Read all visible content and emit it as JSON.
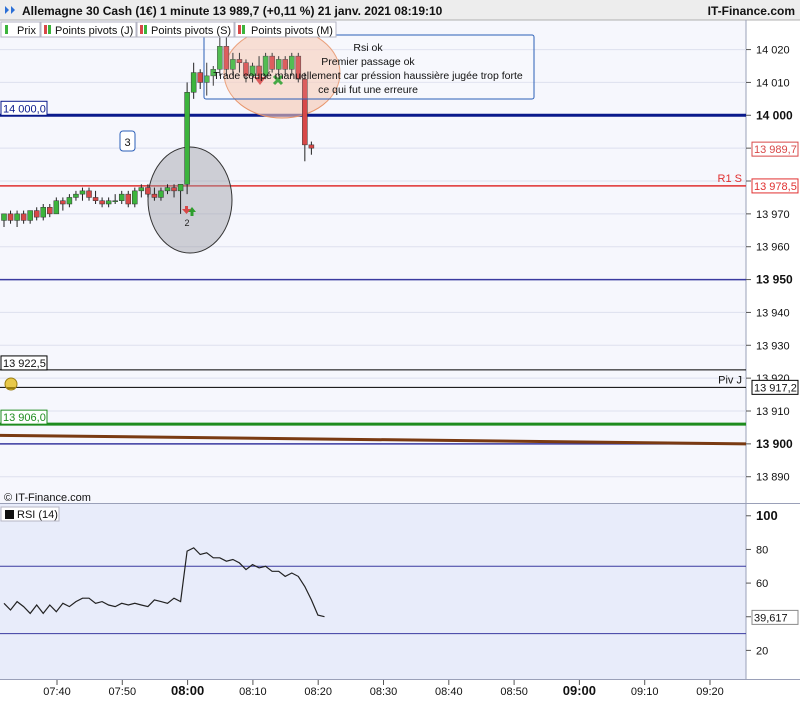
{
  "title_bar": {
    "title": "Allemagne 30 Cash (1€) 1 minute 13 989,7 (+0,11 %) 21 janv. 2021 08:19:10",
    "brand": "IT-Finance.com"
  },
  "tabs": [
    {
      "label": "Prix",
      "icon": "candle-icon"
    },
    {
      "label": "Points pivots (J)",
      "icon": "candle-icon"
    },
    {
      "label": "Points pivots (S)",
      "icon": "candle-icon"
    },
    {
      "label": "Points pivots (M)",
      "icon": "candle-icon"
    }
  ],
  "annotation_box": {
    "lines": [
      "Rsi ok",
      "Premier passage ok",
      "Trade coupé manuellement car préssion haussière jugée trop forte",
      "ce qui fut une erreure"
    ]
  },
  "label_3": "3",
  "label_2": "2",
  "copyright": "© IT-Finance.com",
  "rsi_label": "RSI (14)",
  "colors": {
    "up": "#3cb43c",
    "down": "#d84848",
    "level_14000": "#0a1a8c",
    "r1s": "#e03030",
    "level_13950": "#3a3aa0",
    "level_13906": "#1e8c1e",
    "trend": "#7a3a12",
    "rsi_line": "#222222",
    "rsi_bg": "#e8ecfa",
    "price_bg": "#f6f7fd"
  },
  "chart_data": [
    {
      "type": "candlestick",
      "name": "Allemagne 30 Cash (1€) 1 minute",
      "x_ticks": [
        "07:40",
        "07:50",
        "08:00",
        "08:10",
        "08:20",
        "08:30",
        "08:40",
        "08:50",
        "09:00",
        "09:10",
        "09:20"
      ],
      "x_ticks_bold": [
        "08:00",
        "09:00"
      ],
      "y_ticks": [
        14020,
        14010,
        14000,
        13990,
        13980,
        13970,
        13960,
        13950,
        13940,
        13930,
        13920,
        13910,
        13900,
        13890
      ],
      "y_ticks_labels": [
        "14 020",
        "14 010",
        "14 000",
        "",
        "",
        "13 970",
        "13 960",
        "13 950",
        "13 940",
        "13 930",
        "13 920",
        "13 910",
        "13 900",
        "13 890"
      ],
      "y_ticks_bold": [
        14000,
        13950,
        13900
      ],
      "ylim": [
        13882,
        14029
      ],
      "candles": [
        {
          "o": 13968,
          "h": 13970,
          "l": 13966,
          "c": 13970
        },
        {
          "o": 13970,
          "h": 13971,
          "l": 13967,
          "c": 13968
        },
        {
          "o": 13968,
          "h": 13971,
          "l": 13966,
          "c": 13970
        },
        {
          "o": 13970,
          "h": 13971,
          "l": 13967,
          "c": 13968
        },
        {
          "o": 13968,
          "h": 13971,
          "l": 13967,
          "c": 13971
        },
        {
          "o": 13971,
          "h": 13972,
          "l": 13968,
          "c": 13969
        },
        {
          "o": 13969,
          "h": 13973,
          "l": 13968,
          "c": 13972
        },
        {
          "o": 13972,
          "h": 13973,
          "l": 13969,
          "c": 13970
        },
        {
          "o": 13970,
          "h": 13975,
          "l": 13970,
          "c": 13974
        },
        {
          "o": 13974,
          "h": 13975,
          "l": 13971,
          "c": 13973
        },
        {
          "o": 13973,
          "h": 13976,
          "l": 13972,
          "c": 13975
        },
        {
          "o": 13975,
          "h": 13977,
          "l": 13974,
          "c": 13976
        },
        {
          "o": 13976,
          "h": 13978,
          "l": 13974,
          "c": 13977
        },
        {
          "o": 13977,
          "h": 13978,
          "l": 13974,
          "c": 13975
        },
        {
          "o": 13975,
          "h": 13977,
          "l": 13973,
          "c": 13974
        },
        {
          "o": 13974,
          "h": 13975,
          "l": 13972,
          "c": 13973
        },
        {
          "o": 13973,
          "h": 13975,
          "l": 13972,
          "c": 13974
        },
        {
          "o": 13974,
          "h": 13976,
          "l": 13973,
          "c": 13974
        },
        {
          "o": 13974,
          "h": 13977,
          "l": 13973,
          "c": 13976
        },
        {
          "o": 13976,
          "h": 13977,
          "l": 13972,
          "c": 13973
        },
        {
          "o": 13973,
          "h": 13978,
          "l": 13972,
          "c": 13977
        },
        {
          "o": 13977,
          "h": 13979,
          "l": 13975,
          "c": 13978
        },
        {
          "o": 13978,
          "h": 13979,
          "l": 13975,
          "c": 13976
        },
        {
          "o": 13976,
          "h": 13978,
          "l": 13974,
          "c": 13975
        },
        {
          "o": 13975,
          "h": 13978,
          "l": 13974,
          "c": 13977
        },
        {
          "o": 13977,
          "h": 13979,
          "l": 13976,
          "c": 13978
        },
        {
          "o": 13978,
          "h": 13979,
          "l": 13975,
          "c": 13977
        },
        {
          "o": 13977,
          "h": 13977,
          "l": 13970,
          "c": 13979
        },
        {
          "o": 13979,
          "h": 14010,
          "l": 13976,
          "c": 14007
        },
        {
          "o": 14007,
          "h": 14016,
          "l": 14005,
          "c": 14013
        },
        {
          "o": 14013,
          "h": 14014,
          "l": 14008,
          "c": 14010
        },
        {
          "o": 14010,
          "h": 14016,
          "l": 14006,
          "c": 14012
        },
        {
          "o": 14012,
          "h": 14015,
          "l": 14009,
          "c": 14014
        },
        {
          "o": 14014,
          "h": 14024,
          "l": 14012,
          "c": 14021
        },
        {
          "o": 14021,
          "h": 14024,
          "l": 14012,
          "c": 14014
        },
        {
          "o": 14014,
          "h": 14019,
          "l": 14012,
          "c": 14017
        },
        {
          "o": 14017,
          "h": 14019,
          "l": 14013,
          "c": 14016
        },
        {
          "o": 14016,
          "h": 14017,
          "l": 14010,
          "c": 14012
        },
        {
          "o": 14012,
          "h": 14016,
          "l": 14010,
          "c": 14015
        },
        {
          "o": 14015,
          "h": 14018,
          "l": 14010,
          "c": 14012
        },
        {
          "o": 14012,
          "h": 14019,
          "l": 14011,
          "c": 14018
        },
        {
          "o": 14018,
          "h": 14019,
          "l": 14013,
          "c": 14014
        },
        {
          "o": 14014,
          "h": 14018,
          "l": 14012,
          "c": 14017
        },
        {
          "o": 14017,
          "h": 14018,
          "l": 14012,
          "c": 14014
        },
        {
          "o": 14014,
          "h": 14019,
          "l": 14012,
          "c": 14018
        },
        {
          "o": 14018,
          "h": 14019,
          "l": 14010,
          "c": 14011
        },
        {
          "o": 14011,
          "h": 14013,
          "l": 13986,
          "c": 13991
        },
        {
          "o": 13991,
          "h": 13992,
          "l": 13988,
          "c": 13990
        }
      ],
      "levels": [
        {
          "value": 14000.0,
          "tag": "14 000,0",
          "label": "",
          "color": "#0a1a8c",
          "width": 3
        },
        {
          "value": 13978.5,
          "tag": "13 978,5",
          "label": "R1 S",
          "color": "#e03030",
          "width": 1.5
        },
        {
          "value": 13950.0,
          "tag": "",
          "label": "",
          "color": "#3a3aa0",
          "width": 1.5
        },
        {
          "value": 13922.5,
          "tag": "13 922,5",
          "label": "",
          "color": "#000000",
          "width": 1
        },
        {
          "value": 13917.2,
          "tag": "13 917,2",
          "label": "Piv J",
          "color": "#000000",
          "width": 1
        },
        {
          "value": 13906.0,
          "tag": "13 906,0",
          "label": "",
          "color": "#1e8c1e",
          "width": 3
        },
        {
          "value": 13900.0,
          "tag": "",
          "label": "",
          "color": "#3a3aa0",
          "width": 1.5
        }
      ],
      "trend_line": [
        [
          0,
          13902.6
        ],
        [
          47,
          13900.0
        ]
      ],
      "last_price": {
        "value": 13989.7,
        "tag": "13 989,7"
      }
    },
    {
      "type": "line",
      "name": "RSI (14)",
      "ylim": [
        3,
        107
      ],
      "y_ticks": [
        100,
        80,
        60,
        40,
        20
      ],
      "y_ticks_bold": [
        100
      ],
      "bands": [
        70,
        30
      ],
      "last_value": {
        "value": 39.617,
        "tag": "39,617"
      },
      "values": [
        48,
        44,
        49,
        46,
        42,
        47,
        42,
        47,
        43,
        48,
        46,
        49,
        51,
        51,
        48,
        49,
        47,
        46,
        48,
        47,
        48,
        47,
        46,
        50,
        49,
        48,
        51,
        49,
        79,
        81,
        77,
        78,
        75,
        75,
        73,
        74,
        72,
        68,
        71,
        69,
        70,
        67,
        67,
        64,
        66,
        64,
        58,
        50,
        41,
        40
      ]
    }
  ]
}
